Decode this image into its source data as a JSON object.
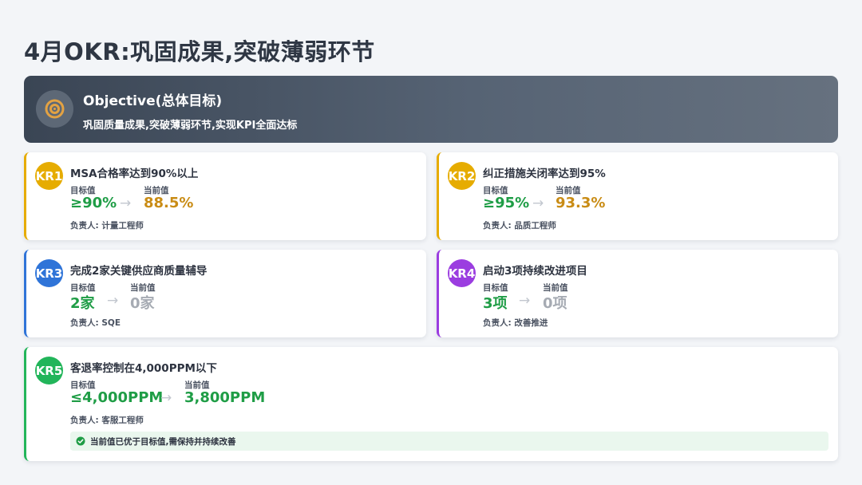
{
  "title": "4月OKR:巩固成果,突破薄弱环节",
  "objective": {
    "heading": "Objective(总体目标)",
    "text": "巩固质量成果,突破薄弱环节,实现KPI全面达标",
    "icon": "target-icon"
  },
  "labels": {
    "target": "目标值",
    "current": "当前值"
  },
  "krs": [
    {
      "badge": "KR1",
      "title": "MSA合格率达到90%以上",
      "target": "≥90%",
      "current": "88.5%",
      "owner": "负责人: 计量工程师",
      "color": "#e6ac00",
      "current_color": "#c98c15"
    },
    {
      "badge": "KR2",
      "title": "纠正措施关闭率达到95%",
      "target": "≥95%",
      "current": "93.3%",
      "owner": "负责人: 品质工程师",
      "color": "#e6ac00",
      "current_color": "#c98c15"
    },
    {
      "badge": "KR3",
      "title": "完成2家关键供应商质量辅导",
      "target": "2家",
      "current": "0家",
      "owner": "负责人: SQE",
      "color": "#2f74d8",
      "current_color": "#a6abb3"
    },
    {
      "badge": "KR4",
      "title": "启动3项持续改进项目",
      "target": "3项",
      "current": "0项",
      "owner": "负责人: 改善推进",
      "color": "#9b3de0",
      "current_color": "#a6abb3"
    },
    {
      "badge": "KR5",
      "title": "客退率控制在4,000PPM以下",
      "target": "≤4,000PPM",
      "current": "3,800PPM",
      "owner": "负责人: 客服工程师",
      "color": "#22b55a",
      "current_color": "#1f9d46",
      "note": "当前值已优于目标值,需保持并持续改善"
    }
  ]
}
